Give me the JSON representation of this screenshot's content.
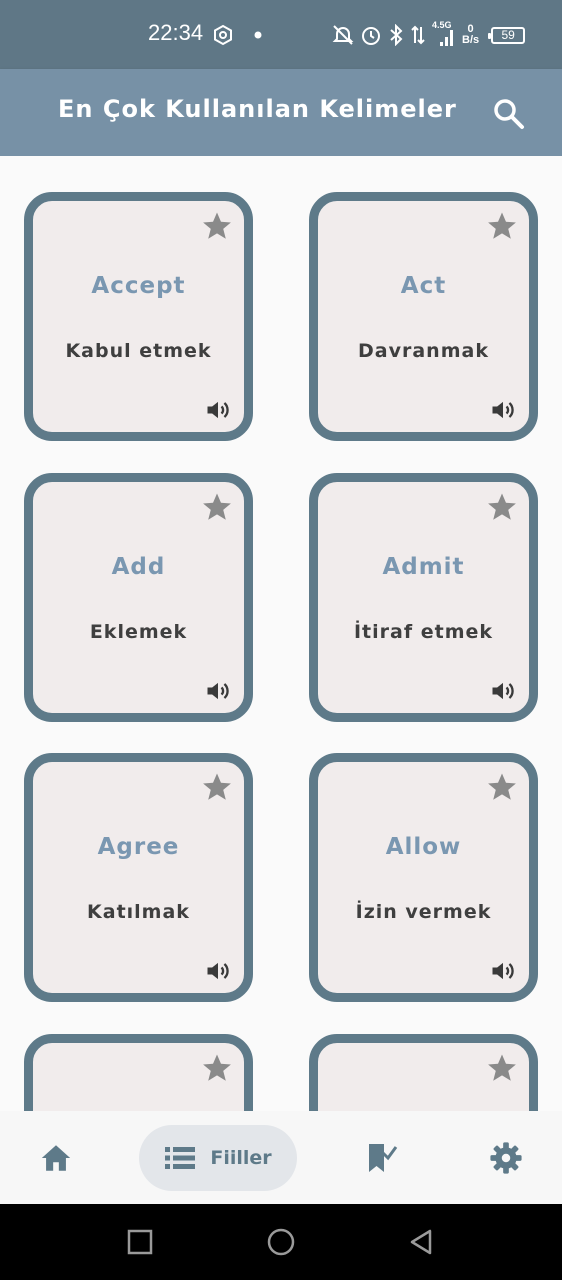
{
  "status_bar": {
    "time": "22:34",
    "network_label": "4.5G",
    "speed_value": "0",
    "speed_unit": "B/s",
    "battery": "59"
  },
  "app_bar": {
    "title": "En Çok Kullanılan Kelimeler",
    "search_icon": "search-icon"
  },
  "cards": [
    {
      "word": "Accept",
      "meaning": "Kabul etmek"
    },
    {
      "word": "Act",
      "meaning": "Davranmak"
    },
    {
      "word": "Add",
      "meaning": "Eklemek"
    },
    {
      "word": "Admit",
      "meaning": "İtiraf etmek"
    },
    {
      "word": "Agree",
      "meaning": "Katılmak"
    },
    {
      "word": "Allow",
      "meaning": "İzin vermek"
    },
    {
      "word": "",
      "meaning": ""
    },
    {
      "word": "",
      "meaning": ""
    }
  ],
  "bottom_nav": {
    "verbs_label": "Fiiller"
  },
  "colors": {
    "status_bar": "#5f7786",
    "app_bar": "#7791a6",
    "card_border": "#5e7a89",
    "card_bg": "#f1ecec",
    "word_text": "#7a97b1",
    "icon_gray": "#8a8a8a"
  }
}
